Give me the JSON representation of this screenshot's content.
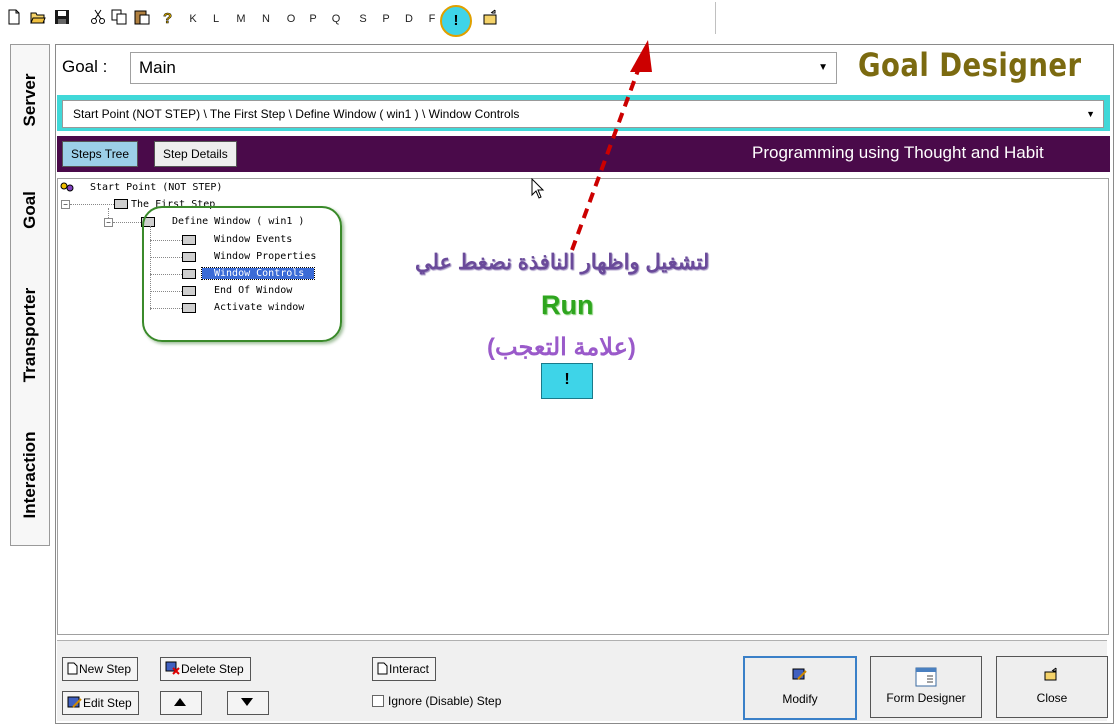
{
  "toolbar": {
    "letters": [
      "K",
      "L",
      "M",
      "N",
      "O",
      "P",
      "Q",
      "S",
      "P",
      "D",
      "F"
    ],
    "run_label": "!"
  },
  "side_tabs": [
    {
      "label": "Server"
    },
    {
      "label": "Goal"
    },
    {
      "label": "Transporter"
    },
    {
      "label": "Interaction"
    }
  ],
  "header": {
    "goal_label": "Goal :",
    "goal_value": "Main",
    "brand": "Goal Designer"
  },
  "path": {
    "value": "Start Point (NOT STEP) \\ The First Step \\ Define Window ( win1 ) \\ Window Controls"
  },
  "tabs": {
    "steps_tree": "Steps Tree",
    "step_details": "Step Details",
    "slogan": "Programming using Thought and Habit"
  },
  "tree": {
    "root": "Start Point (NOT STEP)",
    "first_step": "The First Step",
    "define_window": "Define Window  ( win1 )",
    "children": [
      {
        "label": "Window Events"
      },
      {
        "label": "Window Properties"
      },
      {
        "label": "Window Controls"
      },
      {
        "label": "End Of Window"
      },
      {
        "label": "Activate window"
      }
    ]
  },
  "annotation": {
    "arabic_line": "لتشغيل واظهار النافذة نضغط علي",
    "run": "Run",
    "paren": "(علامة التعجب)",
    "sample_button": "!"
  },
  "bottom": {
    "new_step": "New Step",
    "delete_step": "Delete Step",
    "edit_step": "Edit Step",
    "interact": "Interact",
    "ignore_step": "Ignore (Disable) Step",
    "modify": "Modify",
    "form_designer": "Form Designer",
    "close": "Close"
  },
  "colors": {
    "brand": "#7b6a10",
    "cyan_bar": "#40d8d8",
    "purple_bar": "#4a0a4a",
    "selected": "#3b6bd6",
    "annotation_arrow": "#cc0000",
    "run_green": "#2ea51e"
  }
}
